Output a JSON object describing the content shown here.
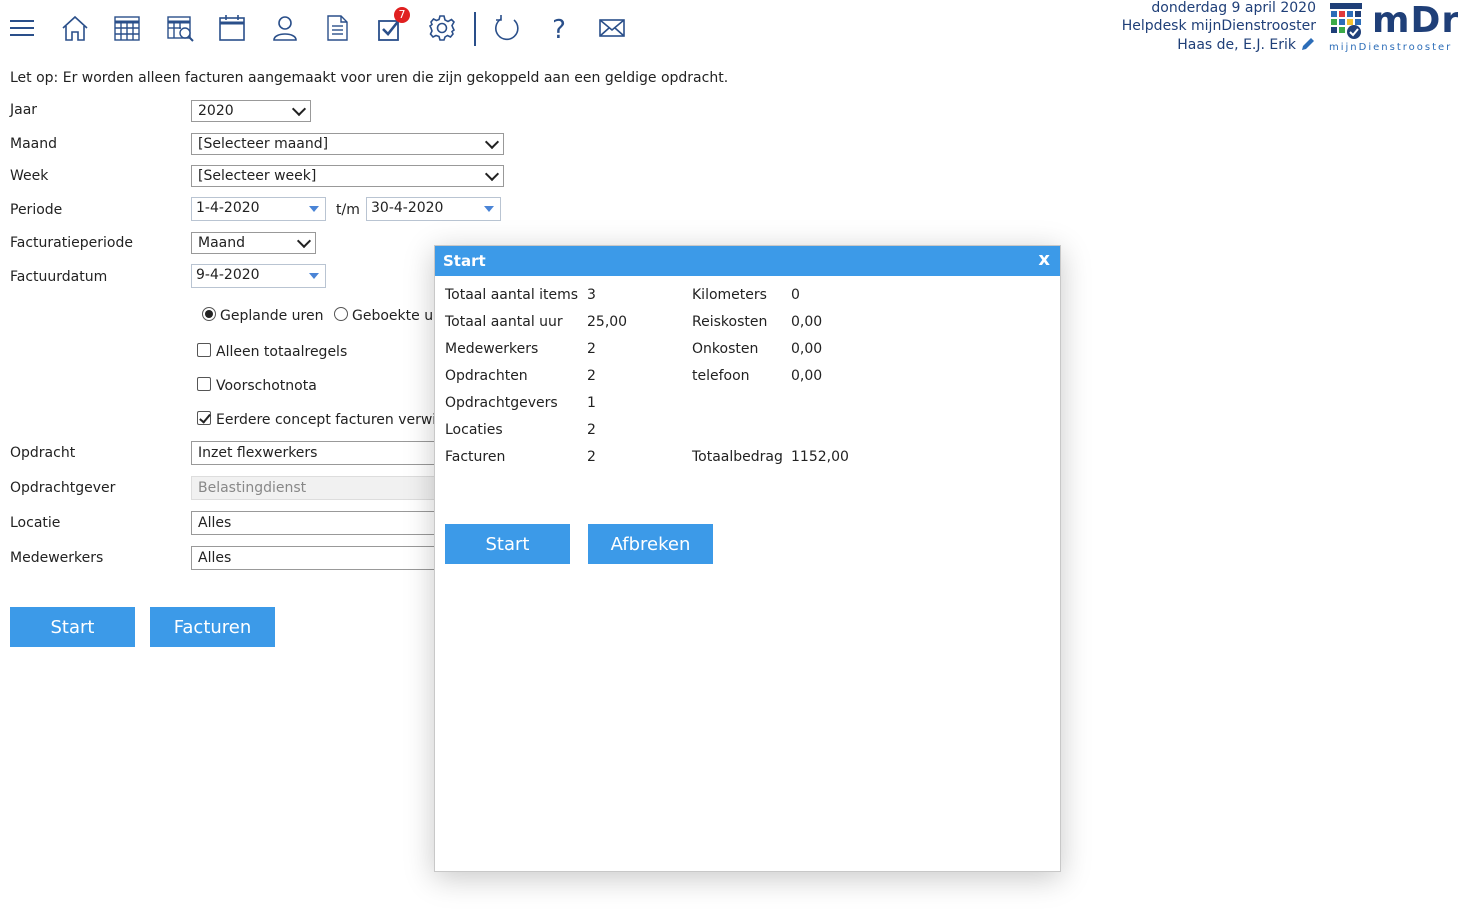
{
  "header": {
    "date": "donderdag 9 april 2020",
    "helpdesk": "Helpdesk mijnDienstrooster",
    "user": "Haas de, E.J. Erik",
    "logo_text": "mDr",
    "logo_sub": "mijnDienstrooster"
  },
  "toolbar": {
    "notification_count": "7",
    "icons": [
      "menu-icon",
      "home-icon",
      "calendar-grid-icon",
      "calendar-search-icon",
      "calendar-icon",
      "user-icon",
      "document-icon",
      "tasks-check-icon",
      "gear-icon",
      "refresh-icon",
      "help-icon",
      "mail-icon"
    ]
  },
  "notice": "Let op: Er worden alleen facturen aangemaakt voor uren die zijn gekoppeld aan een geldige opdracht.",
  "form": {
    "jaar_label": "Jaar",
    "jaar_value": "2020",
    "maand_label": "Maand",
    "maand_value": "[Selecteer maand]",
    "week_label": "Week",
    "week_value": "[Selecteer week]",
    "periode_label": "Periode",
    "periode_from": "1-4-2020",
    "periode_sep": "t/m",
    "periode_to": "30-4-2020",
    "factperiode_label": "Facturatieperiode",
    "factperiode_value": "Maand",
    "factuurdatum_label": "Factuurdatum",
    "factuurdatum_value": "9-4-2020",
    "radio_gepland": "Geplande uren",
    "radio_geboekt": "Geboekte ur",
    "chk_totaal": "Alleen totaalregels",
    "chk_voorschot": "Voorschotnota",
    "chk_eerdere": "Eerdere concept facturen verwij",
    "opdracht_label": "Opdracht",
    "opdracht_value": "Inzet flexwerkers",
    "opdrachtgever_label": "Opdrachtgever",
    "opdrachtgever_value": "Belastingdienst",
    "locatie_label": "Locatie",
    "locatie_value": "Alles",
    "medewerkers_label": "Medewerkers",
    "medewerkers_value": "Alles",
    "start_button": "Start",
    "facturen_button": "Facturen"
  },
  "modal": {
    "title": "Start",
    "close": "x",
    "left": [
      {
        "label": "Totaal aantal items",
        "value": "3"
      },
      {
        "label": "Totaal aantal uur",
        "value": "25,00"
      },
      {
        "label": "Medewerkers",
        "value": "2"
      },
      {
        "label": "Opdrachten",
        "value": "2"
      },
      {
        "label": "Opdrachtgevers",
        "value": "1"
      },
      {
        "label": "Locaties",
        "value": "2"
      },
      {
        "label": "Facturen",
        "value": "2"
      }
    ],
    "right": [
      {
        "label": "Kilometers",
        "value": "0"
      },
      {
        "label": "Reiskosten",
        "value": "0,00"
      },
      {
        "label": "Onkosten",
        "value": "0,00"
      },
      {
        "label": "telefoon",
        "value": "0,00"
      }
    ],
    "total_label": "Totaalbedrag",
    "total_value": "1152,00",
    "start_button": "Start",
    "cancel_button": "Afbreken"
  }
}
